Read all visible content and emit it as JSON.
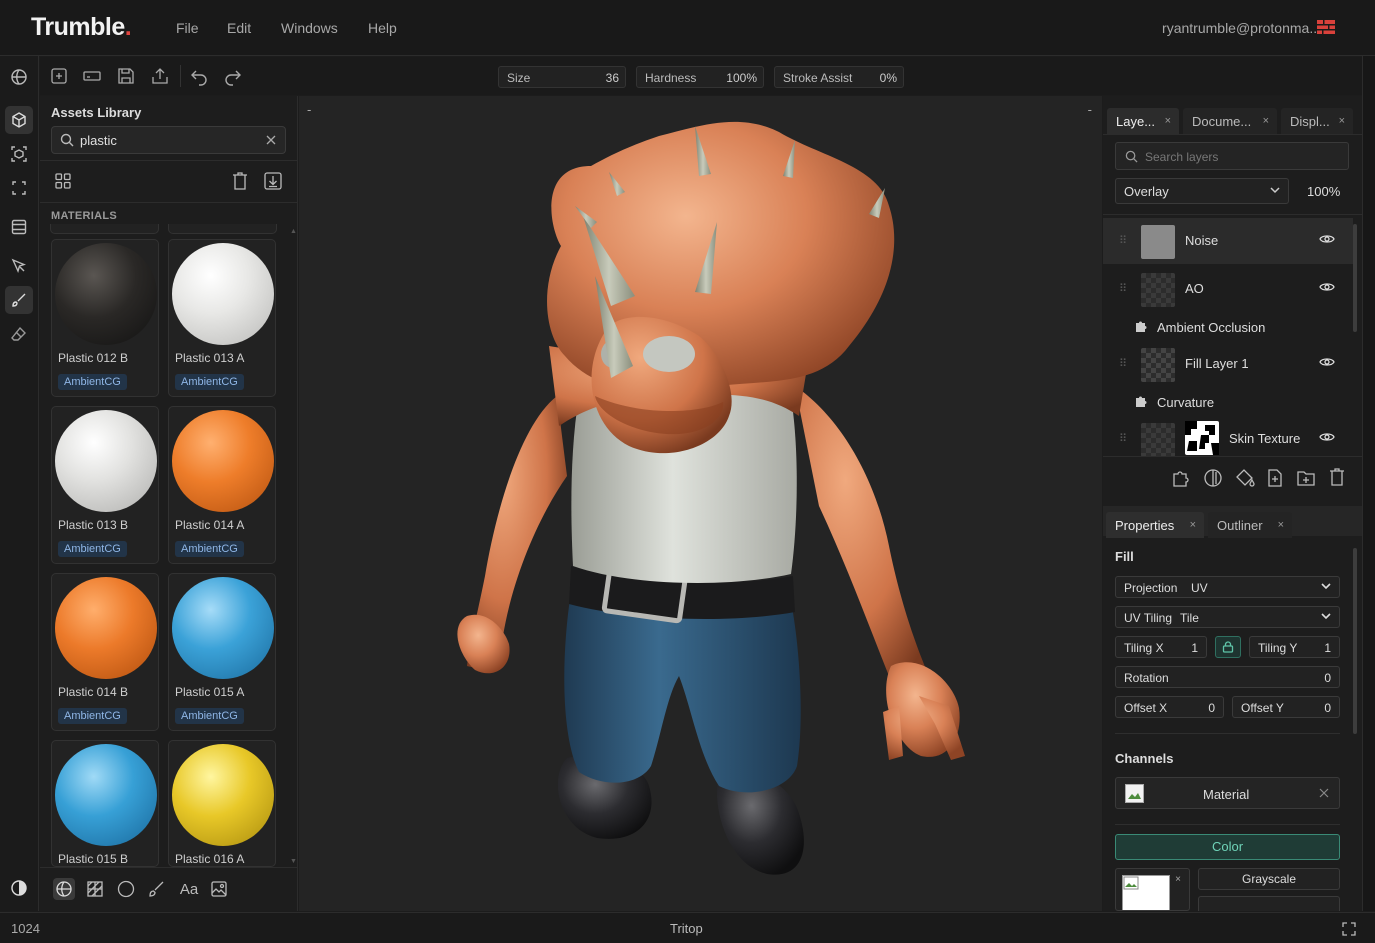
{
  "app": {
    "logo_text": "Trumble",
    "logo_dot": ".",
    "user": "ryantrumble@protonma...",
    "accent": "#e0443e"
  },
  "menu": [
    "File",
    "Edit",
    "Windows",
    "Help"
  ],
  "toolbar": {
    "size": {
      "label": "Size",
      "value": "36"
    },
    "hardness": {
      "label": "Hardness",
      "value": "100%"
    },
    "stroke_assist": {
      "label": "Stroke Assist",
      "value": "0%"
    }
  },
  "assets": {
    "title": "Assets Library",
    "search_value": "plastic",
    "section_label": "MATERIALS",
    "materials": [
      {
        "name": "Plastic 012 B",
        "source": "AmbientCG",
        "color": "#262422"
      },
      {
        "name": "Plastic 013 A",
        "source": "AmbientCG",
        "color": "#e6e6e4"
      },
      {
        "name": "Plastic 013 B",
        "source": "AmbientCG",
        "color": "#dcdcda"
      },
      {
        "name": "Plastic 014 A",
        "source": "AmbientCG",
        "color": "#ee7d2a"
      },
      {
        "name": "Plastic 014 B",
        "source": "AmbientCG",
        "color": "#ec7a2a"
      },
      {
        "name": "Plastic 015 A",
        "source": "AmbientCG",
        "color": "#3ba2d8"
      },
      {
        "name": "Plastic 015 B",
        "source": "AmbientCG",
        "color": "#37a0d6"
      },
      {
        "name": "Plastic 016 A",
        "source": "",
        "color": "#e8c828"
      }
    ]
  },
  "viewport": {
    "minus_left": "-",
    "minus_right": "-"
  },
  "tabs_top": [
    {
      "label": "Laye...",
      "close": "×"
    },
    {
      "label": "Docume...",
      "close": "×"
    },
    {
      "label": "Displ...",
      "close": "×"
    }
  ],
  "layers": {
    "search_placeholder": "Search layers",
    "blend_mode": "Overlay",
    "opacity": "100%",
    "items": [
      {
        "name": "Noise",
        "type": "layer"
      },
      {
        "name": "AO",
        "type": "layer"
      },
      {
        "name": "Ambient Occlusion",
        "type": "effect"
      },
      {
        "name": "Fill Layer 1",
        "type": "layer"
      },
      {
        "name": "Curvature",
        "type": "effect"
      },
      {
        "name": "Skin Texture",
        "type": "layer"
      }
    ]
  },
  "tabs_bottom": [
    {
      "label": "Properties",
      "close": "×"
    },
    {
      "label": "Outliner",
      "close": "×"
    }
  ],
  "properties": {
    "fill_title": "Fill",
    "projection": {
      "label": "Projection",
      "value": "UV"
    },
    "uv_tiling": {
      "label": "UV Tiling",
      "value": "Tile"
    },
    "tiling_x": {
      "label": "Tiling X",
      "value": "1"
    },
    "tiling_y": {
      "label": "Tiling Y",
      "value": "1"
    },
    "rotation": {
      "label": "Rotation",
      "value": "0"
    },
    "offset_x": {
      "label": "Offset X",
      "value": "0"
    },
    "offset_y": {
      "label": "Offset Y",
      "value": "0"
    },
    "channels_title": "Channels",
    "channel_material": "Material",
    "color_button": "Color",
    "grayscale_button": "Grayscale"
  },
  "status": {
    "resolution": "1024",
    "project": "Tritop"
  }
}
